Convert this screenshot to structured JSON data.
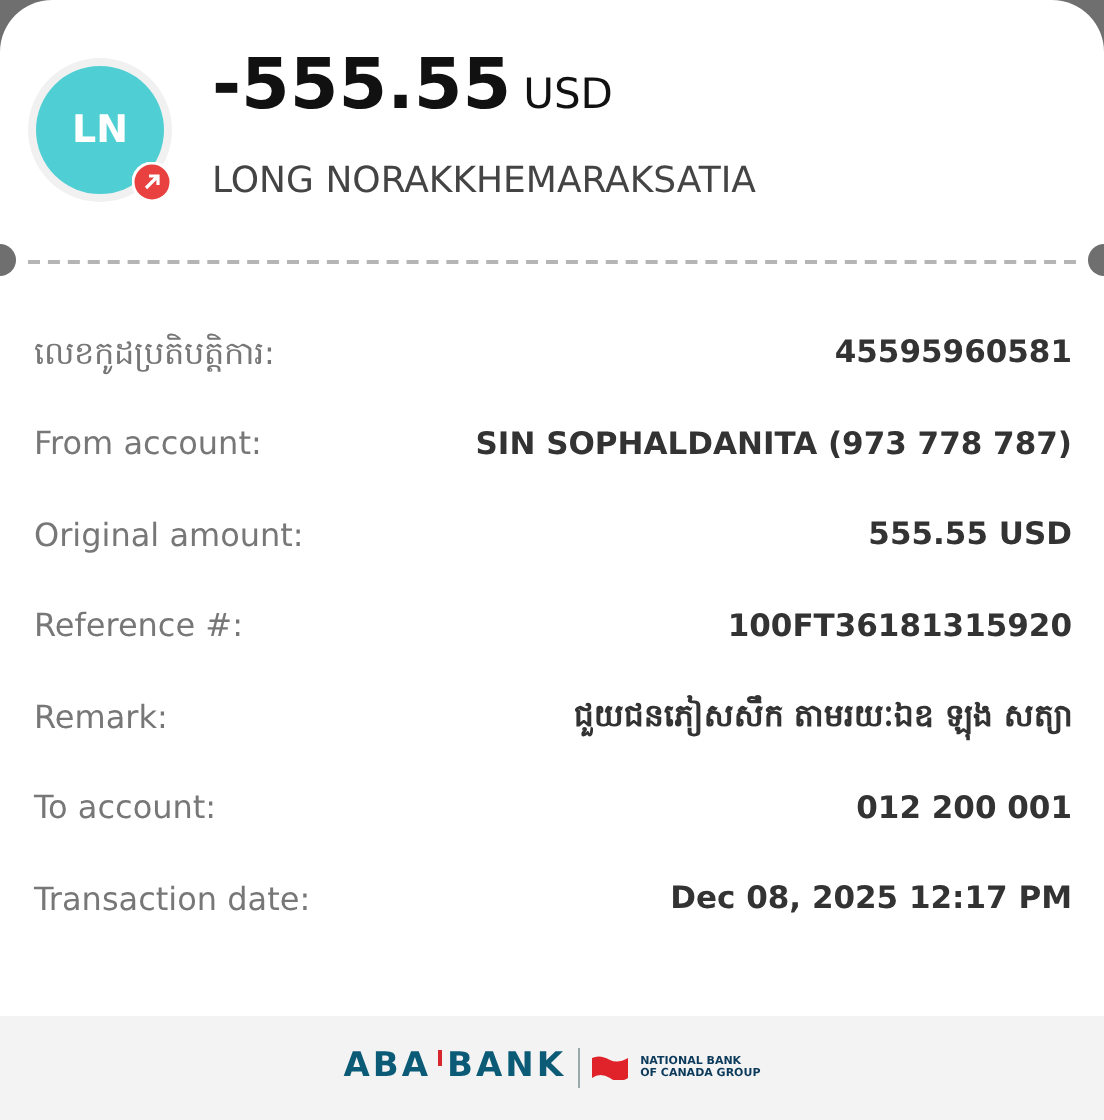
{
  "header": {
    "avatar": {
      "initials": "LN",
      "outgoing": true
    },
    "amount": "-555.55",
    "currency": "USD",
    "name": "LONG NORAKKHEMARAKSATIA"
  },
  "details": [
    {
      "label": "លេខកូដប្រតិបត្តិការ:",
      "value": "45595960581"
    },
    {
      "label": "From account:",
      "value": "SIN SOPHALDANITA (973 778 787)"
    },
    {
      "label": "Original amount:",
      "value": "555.55 USD"
    },
    {
      "label": "Reference #:",
      "value": "100FT36181315920"
    },
    {
      "label": "Remark:",
      "value": "ជួយជនភៀសសឹក តាមរយៈឯឧ ឡុង សត្យា"
    },
    {
      "label": "To account:",
      "value": "012 200 001"
    },
    {
      "label": "Transaction date:",
      "value": "Dec 08, 2025 12:17 PM"
    }
  ],
  "footer": {
    "logo_left": "ABA",
    "logo_right": "BANK",
    "partner": [
      "NATIONAL BANK",
      "OF CANADA GROUP"
    ]
  }
}
